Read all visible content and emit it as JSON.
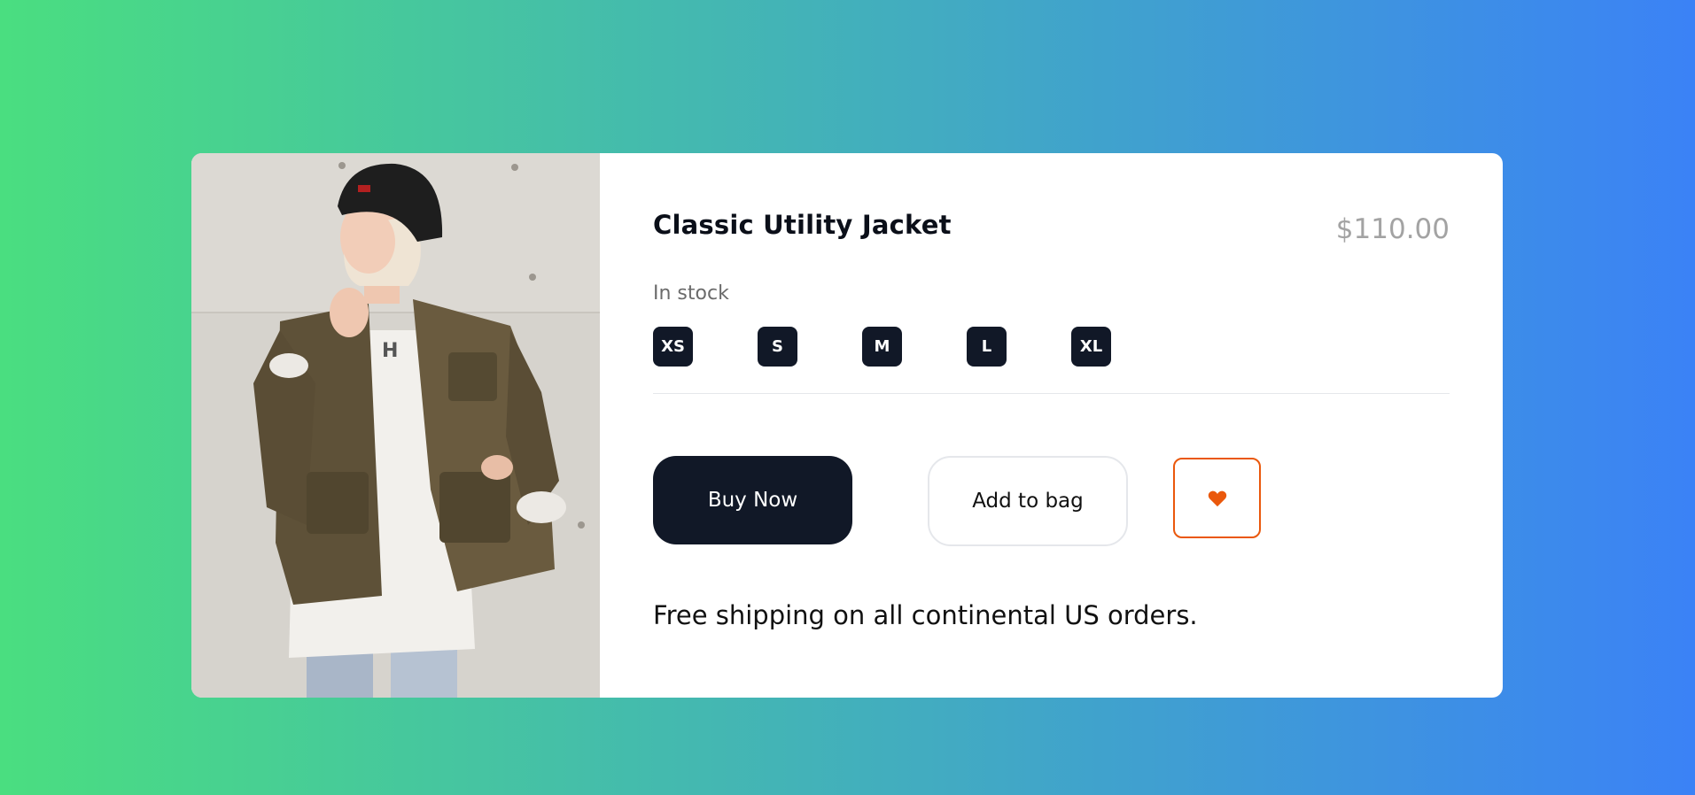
{
  "product": {
    "title": "Classic Utility Jacket",
    "price": "$110.00",
    "stock_status": "In stock",
    "sizes": [
      "XS",
      "S",
      "M",
      "L",
      "XL"
    ],
    "shipping_note": "Free shipping on all continental US orders."
  },
  "actions": {
    "buy_label": "Buy Now",
    "bag_label": "Add to bag",
    "favorite_icon": "heart-icon"
  },
  "colors": {
    "background_gradient_start": "#4ade80",
    "background_gradient_end": "#3b82f6",
    "primary_dark": "#111827",
    "accent_orange": "#ea580c",
    "price_gray": "#a3a3a3"
  }
}
